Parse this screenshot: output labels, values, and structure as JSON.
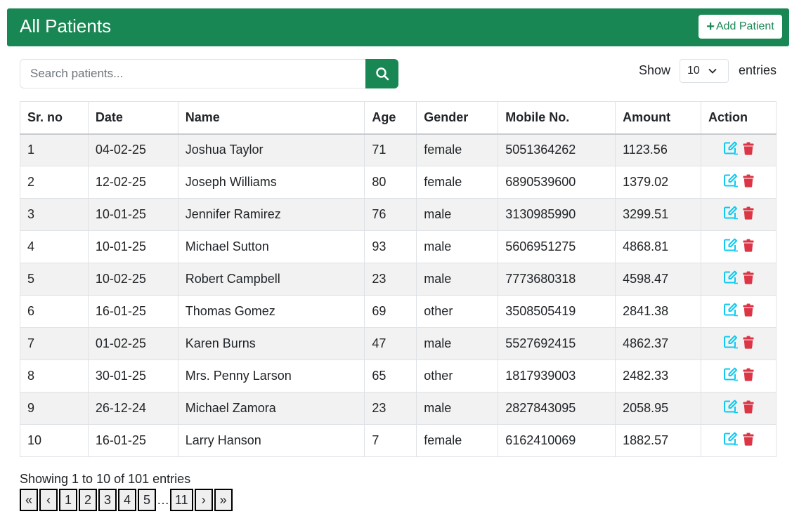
{
  "header": {
    "title": "All Patients",
    "add_label": "Add Patient"
  },
  "search": {
    "placeholder": "Search patients...",
    "value": ""
  },
  "entries": {
    "show_label": "Show",
    "value": "10",
    "suffix": "entries"
  },
  "table": {
    "columns": [
      "Sr. no",
      "Date",
      "Name",
      "Age",
      "Gender",
      "Mobile No.",
      "Amount",
      "Action"
    ],
    "rows": [
      [
        "1",
        "04-02-25",
        "Joshua Taylor",
        "71",
        "female",
        "5051364262",
        "1123.56"
      ],
      [
        "2",
        "12-02-25",
        "Joseph Williams",
        "80",
        "female",
        "6890539600",
        "1379.02"
      ],
      [
        "3",
        "10-01-25",
        "Jennifer Ramirez",
        "76",
        "male",
        "3130985990",
        "3299.51"
      ],
      [
        "4",
        "10-01-25",
        "Michael Sutton",
        "93",
        "male",
        "5606951275",
        "4868.81"
      ],
      [
        "5",
        "10-02-25",
        "Robert Campbell",
        "23",
        "male",
        "7773680318",
        "4598.47"
      ],
      [
        "6",
        "16-01-25",
        "Thomas Gomez",
        "69",
        "other",
        "3508505419",
        "2841.38"
      ],
      [
        "7",
        "01-02-25",
        "Karen Burns",
        "47",
        "male",
        "5527692415",
        "4862.37"
      ],
      [
        "8",
        "30-01-25",
        "Mrs. Penny Larson",
        "65",
        "other",
        "1817939003",
        "2482.33"
      ],
      [
        "9",
        "26-12-24",
        "Michael Zamora",
        "23",
        "male",
        "2827843095",
        "2058.95"
      ],
      [
        "10",
        "16-01-25",
        "Larry Hanson",
        "7",
        "female",
        "6162410069",
        "1882.57"
      ]
    ]
  },
  "footer": {
    "showing": "Showing 1 to 10 of 101 entries",
    "pagination": {
      "first": "«",
      "prev": "‹",
      "pages": [
        "1",
        "2",
        "3",
        "4",
        "5"
      ],
      "ellipsis": "…",
      "last_page": "11",
      "next": "›",
      "last": "»"
    }
  },
  "colors": {
    "primary": "#198754",
    "edit": "#0dcaf0",
    "delete": "#dc3545"
  },
  "icons": {
    "search": "search-icon",
    "edit": "edit-icon",
    "delete": "trash-icon",
    "add": "plus-icon",
    "dropdown": "chevron-down-icon"
  }
}
